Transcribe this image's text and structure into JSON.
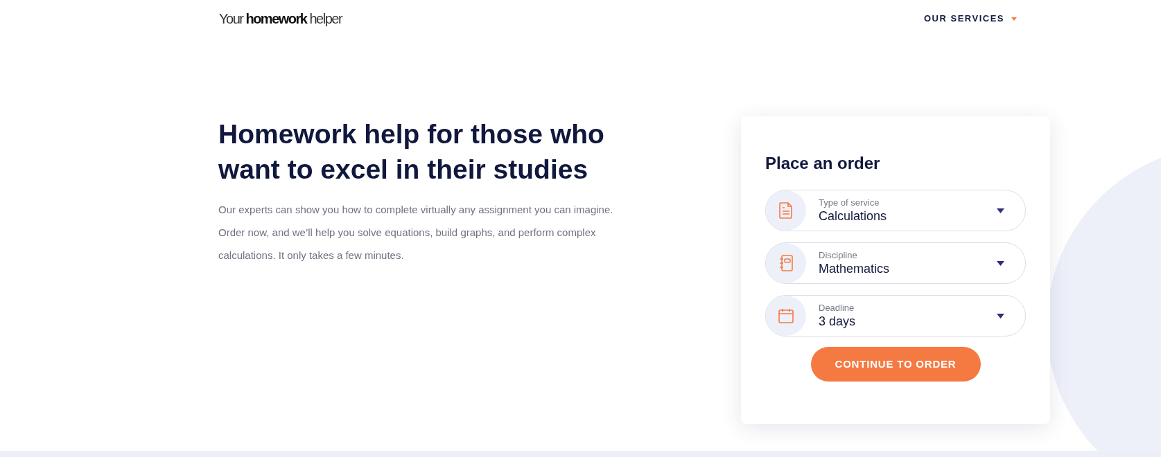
{
  "logo": {
    "parts": [
      {
        "text": "Your",
        "bold": false
      },
      {
        "text": "homework",
        "bold": true
      },
      {
        "text": "helper",
        "bold": false
      }
    ]
  },
  "nav": {
    "label": "OUR SERVICES"
  },
  "hero": {
    "heading": "Homework help for those who want to excel in their studies",
    "text": "Our experts can show you how to complete virtually any assignment you can imagine. Order now, and we’ll help you solve equations, build graphs, and perform complex calculations. It only takes a few minutes."
  },
  "order_form": {
    "title": "Place an order",
    "fields": [
      {
        "kind": "document",
        "label": "Type of service",
        "value": "Calculations"
      },
      {
        "kind": "notebook",
        "label": "Discipline",
        "value": "Mathematics"
      },
      {
        "kind": "calendar",
        "label": "Deadline",
        "value": "3 days"
      }
    ],
    "button": "CONTINUE TO ORDER"
  }
}
